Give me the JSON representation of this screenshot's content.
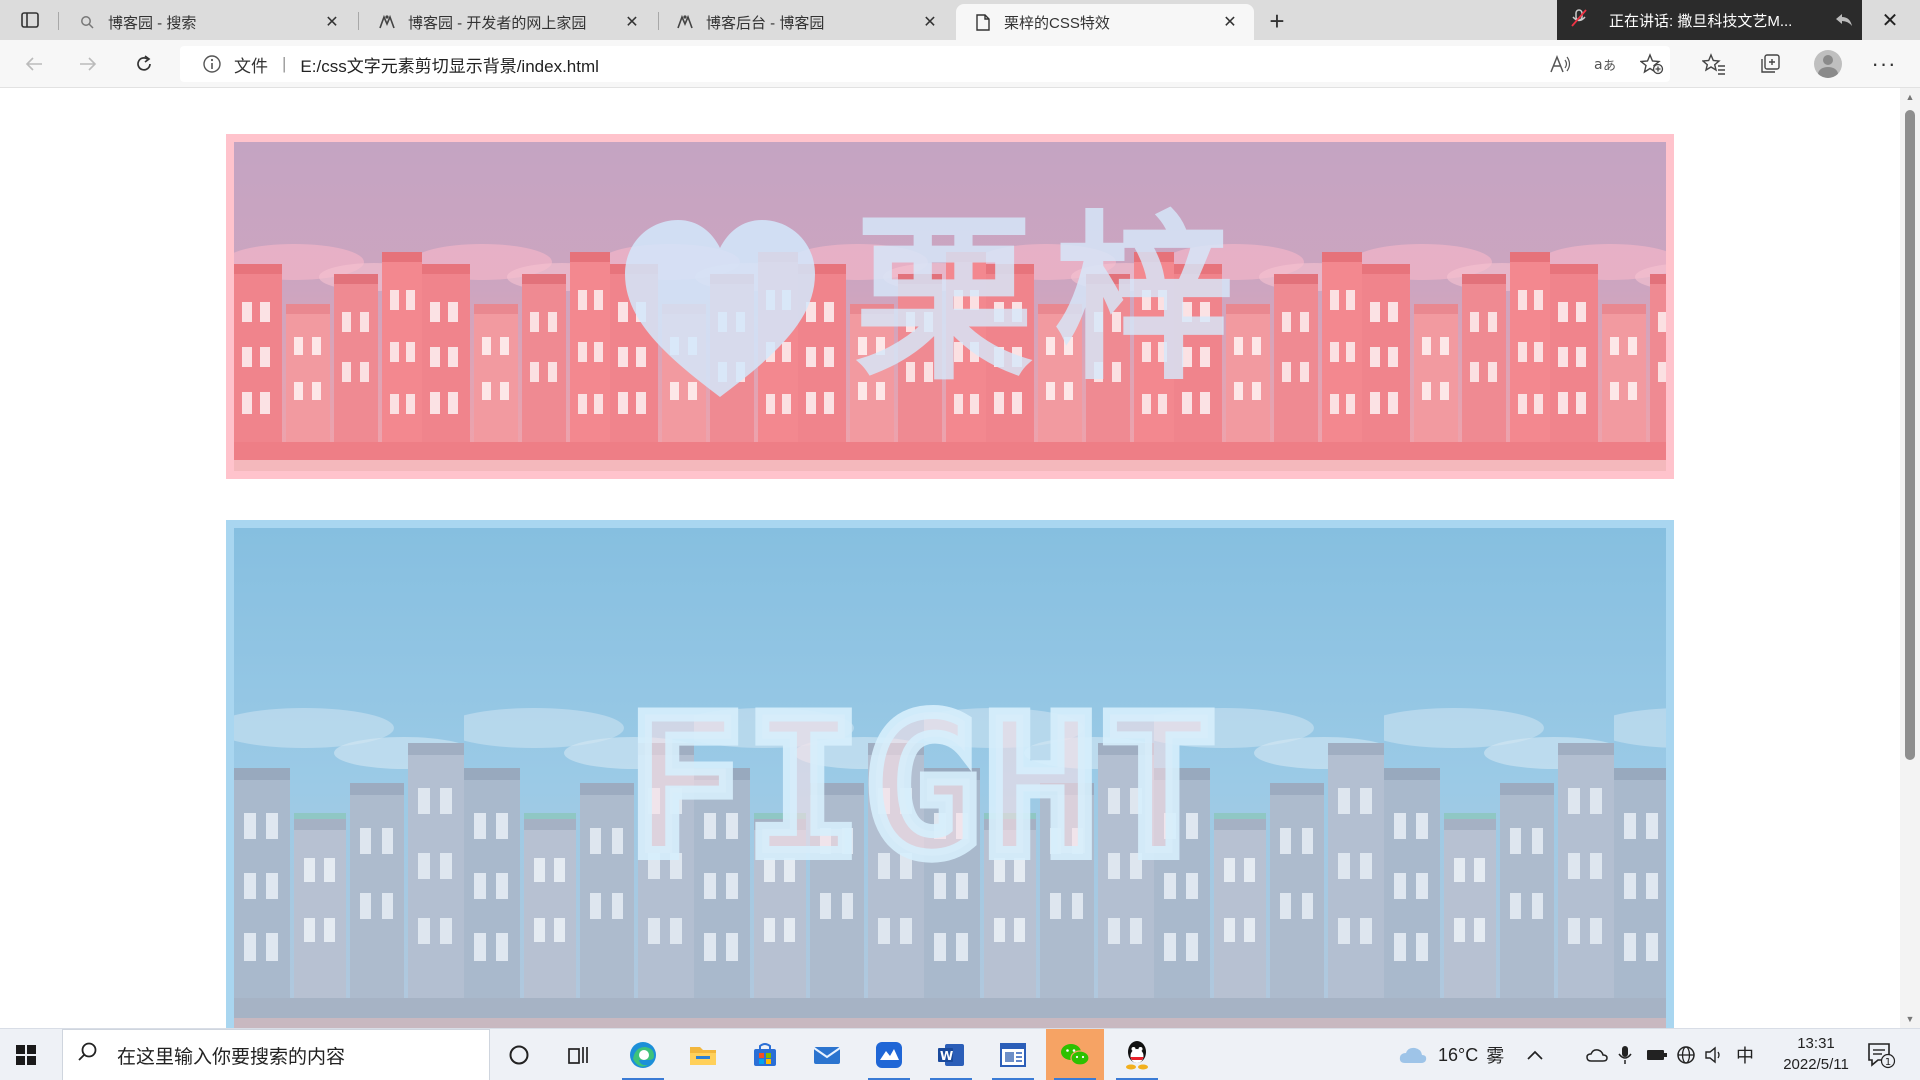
{
  "browser": {
    "tabs": [
      {
        "label": "博客园 - 搜索",
        "icon": "search-icon",
        "active": false
      },
      {
        "label": "博客园 - 开发者的网上家园",
        "icon": "cnblogs-icon",
        "active": false
      },
      {
        "label": "博客后台 - 博客园",
        "icon": "cnblogs-icon",
        "active": false
      },
      {
        "label": "栗梓的CSS特效",
        "icon": "page-icon",
        "active": true
      }
    ],
    "media_indicator": "正在讲话: 撒旦科技文艺M...",
    "address": {
      "scheme_label": "文件",
      "url": "E:/css文字元素剪切显示背景/index.html"
    }
  },
  "page": {
    "banners": [
      {
        "text": "栗梓",
        "theme": "pink",
        "border_color": "#ffc3cc"
      },
      {
        "text": "FIGHT",
        "theme": "blue",
        "border_color": "#a9d6f0"
      }
    ]
  },
  "taskbar": {
    "search_placeholder": "在这里输入你要搜索的内容",
    "weather": {
      "temp": "16°C",
      "condition": "雾"
    },
    "ime": "中",
    "time": "13:31",
    "date": "2022/5/11",
    "notification_count": "1"
  }
}
